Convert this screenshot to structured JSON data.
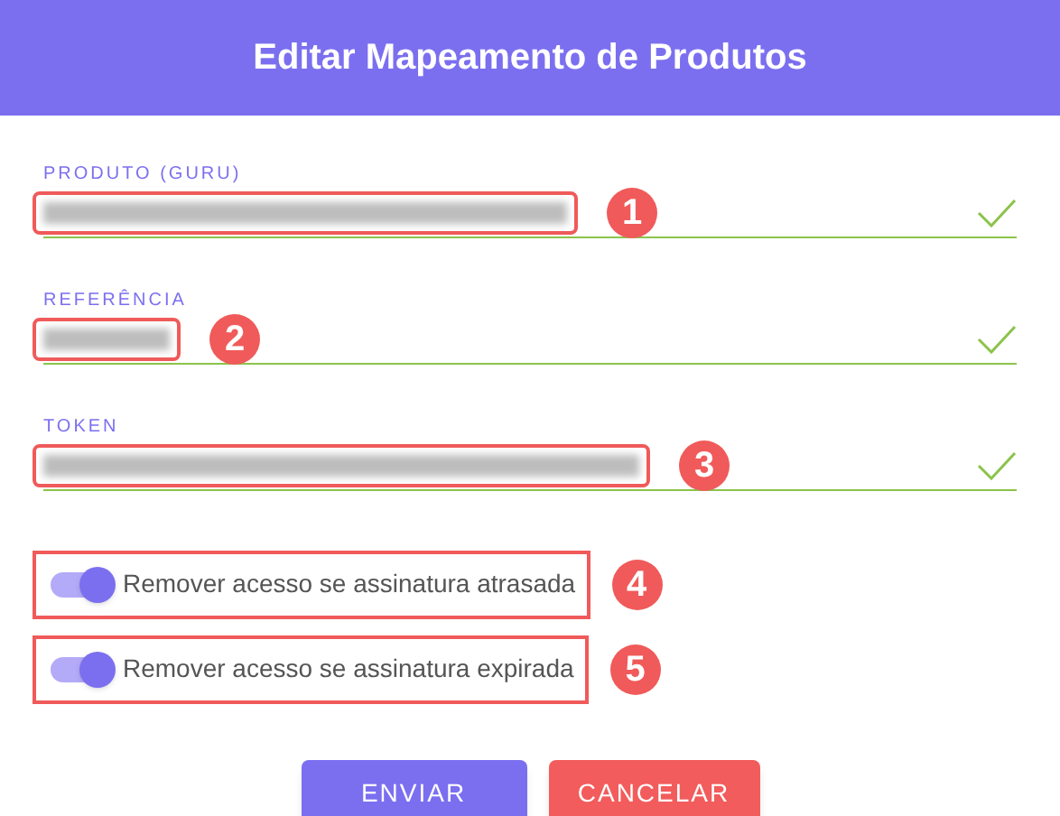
{
  "dialog": {
    "title": "Editar Mapeamento de Produtos"
  },
  "fields": [
    {
      "label": "PRODUTO (GURU)",
      "redacted": true,
      "valid": true,
      "marker": "1"
    },
    {
      "label": "REFERÊNCIA",
      "redacted": true,
      "valid": true,
      "marker": "2"
    },
    {
      "label": "TOKEN",
      "redacted": true,
      "valid": true,
      "marker": "3"
    }
  ],
  "toggles": [
    {
      "label": "Remover acesso se assinatura atrasada",
      "on": true,
      "marker": "4"
    },
    {
      "label": "Remover acesso se assinatura expirada",
      "on": true,
      "marker": "5"
    }
  ],
  "buttons": [
    {
      "label": "ENVIAR",
      "kind": "primary"
    },
    {
      "label": "CANCELAR",
      "kind": "danger"
    }
  ]
}
